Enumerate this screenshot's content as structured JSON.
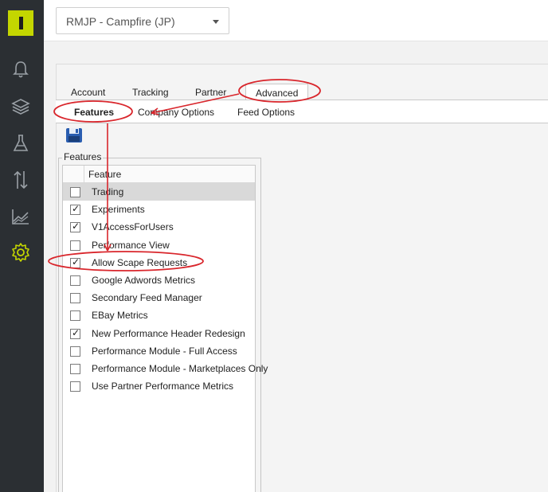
{
  "account_selector": {
    "value": "RMJP - Campfire (JP)"
  },
  "tabs": [
    {
      "label": "Account"
    },
    {
      "label": "Tracking"
    },
    {
      "label": "Partner"
    },
    {
      "label": "Advanced"
    }
  ],
  "subtabs": [
    {
      "label": "Features"
    },
    {
      "label": "Company Options"
    },
    {
      "label": "Feed Options"
    }
  ],
  "features_panel": {
    "legend": "Features",
    "column_header": "Feature",
    "rows": [
      {
        "label": "Trading",
        "checked": false
      },
      {
        "label": "Experiments",
        "checked": true
      },
      {
        "label": "V1AccessForUsers",
        "checked": true
      },
      {
        "label": "Performance View",
        "checked": false
      },
      {
        "label": "Allow Scape Requests",
        "checked": true
      },
      {
        "label": "Google Adwords Metrics",
        "checked": false
      },
      {
        "label": "Secondary Feed Manager",
        "checked": false
      },
      {
        "label": "EBay Metrics",
        "checked": false
      },
      {
        "label": "New Performance Header Redesign",
        "checked": true
      },
      {
        "label": "Performance Module - Full Access",
        "checked": false
      },
      {
        "label": "Performance Module - Marketplaces Only",
        "checked": false
      },
      {
        "label": "Use Partner Performance Metrics",
        "checked": false
      }
    ]
  },
  "sidebar": {
    "icons": [
      "bell-icon",
      "layers-icon",
      "flask-icon",
      "sort-arrows-icon",
      "area-chart-icon",
      "gear-icon"
    ]
  },
  "colors": {
    "brand": "#c4d600",
    "sidebar": "#2b2f33",
    "annotation": "#d9262c",
    "active_nav": "#c4d600"
  }
}
